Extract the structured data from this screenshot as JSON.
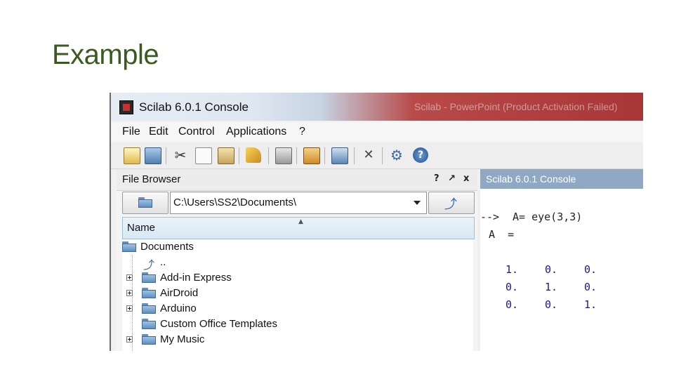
{
  "slide": {
    "title": "Example"
  },
  "window": {
    "title": "Scilab 6.0.1 Console",
    "background_window_title": "Scilab - PowerPoint (Product Activation Failed)"
  },
  "menu": {
    "items": [
      "File",
      "Edit",
      "Control",
      "Applications",
      "?"
    ]
  },
  "toolbar": {
    "icons": [
      "new-script-icon",
      "open-folder-icon",
      "cut-icon",
      "copy-icon",
      "paste-icon",
      "clear-console-icon",
      "print-icon",
      "browse-variables-icon",
      "module-manager-icon",
      "preferences-icon",
      "gear-icon",
      "help-icon"
    ]
  },
  "file_browser": {
    "title": "File Browser",
    "controls": [
      "?",
      "↗",
      "x"
    ],
    "path": "C:\\Users\\SS2\\Documents\\",
    "column_header": "Name",
    "tree": [
      {
        "label": "Documents",
        "level": 0,
        "icon": "folder-icon",
        "expander": false
      },
      {
        "label": "..",
        "level": 1,
        "icon": "up-arrow-icon",
        "expander": false
      },
      {
        "label": "Add-in Express",
        "level": 1,
        "icon": "folder-icon",
        "expander": true
      },
      {
        "label": "AirDroid",
        "level": 1,
        "icon": "folder-icon",
        "expander": true
      },
      {
        "label": "Arduino",
        "level": 1,
        "icon": "folder-icon",
        "expander": true
      },
      {
        "label": "Custom Office Templates",
        "level": 1,
        "icon": "folder-icon",
        "expander": false
      },
      {
        "label": "My Music",
        "level": 1,
        "icon": "folder-icon",
        "expander": true
      }
    ]
  },
  "console": {
    "title": "Scilab 6.0.1 Console",
    "prompt": "-->",
    "command": "A= eye(3,3)",
    "output_label": "A  =",
    "matrix": [
      [
        "1.",
        "0.",
        "0."
      ],
      [
        "0.",
        "1.",
        "0."
      ],
      [
        "0.",
        "0.",
        "1."
      ]
    ]
  },
  "colors": {
    "title_green": "#3a5a22",
    "console_header": "#8fa8c4",
    "titlebar_red": "#a83636"
  }
}
